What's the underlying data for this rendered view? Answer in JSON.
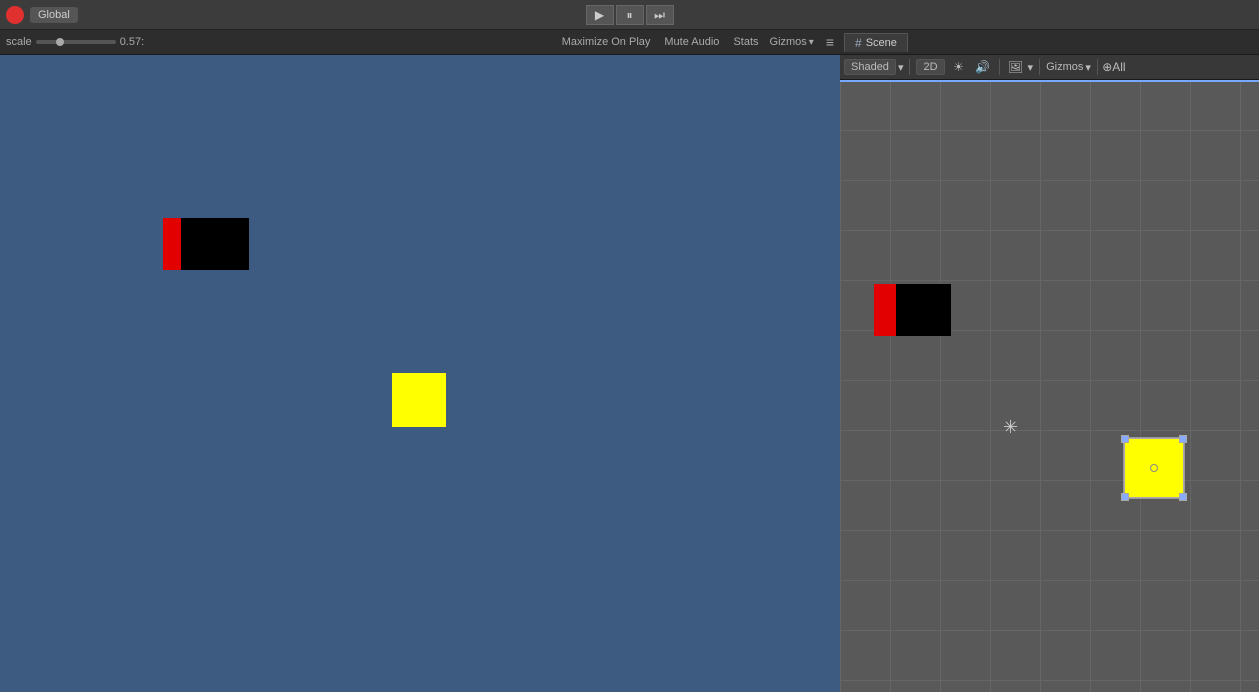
{
  "toolbar": {
    "logo_color": "#e03030",
    "global_label": "Global",
    "play_btn_label": "▶",
    "pause_btn_label": "⏸",
    "next_btn_label": "⏭"
  },
  "game_panel": {
    "scale_label": "scale",
    "scale_value": "0.57:",
    "maximize_on_play": "Maximize On Play",
    "mute_audio": "Mute Audio",
    "stats": "Stats",
    "gizmos": "Gizmos",
    "menu_icon": "≡"
  },
  "scene_panel": {
    "tab_label": "Scene",
    "tab_icon": "#",
    "shaded_label": "Shaded",
    "shaded_dropdown": "▾",
    "two_d_label": "2D",
    "sun_icon": "☀",
    "speaker_icon": "🔊",
    "image_icon": "🖼",
    "image_dropdown": "▾",
    "gizmos_label": "Gizmos",
    "gizmos_dropdown": "▾",
    "all_label": "⊕All"
  }
}
